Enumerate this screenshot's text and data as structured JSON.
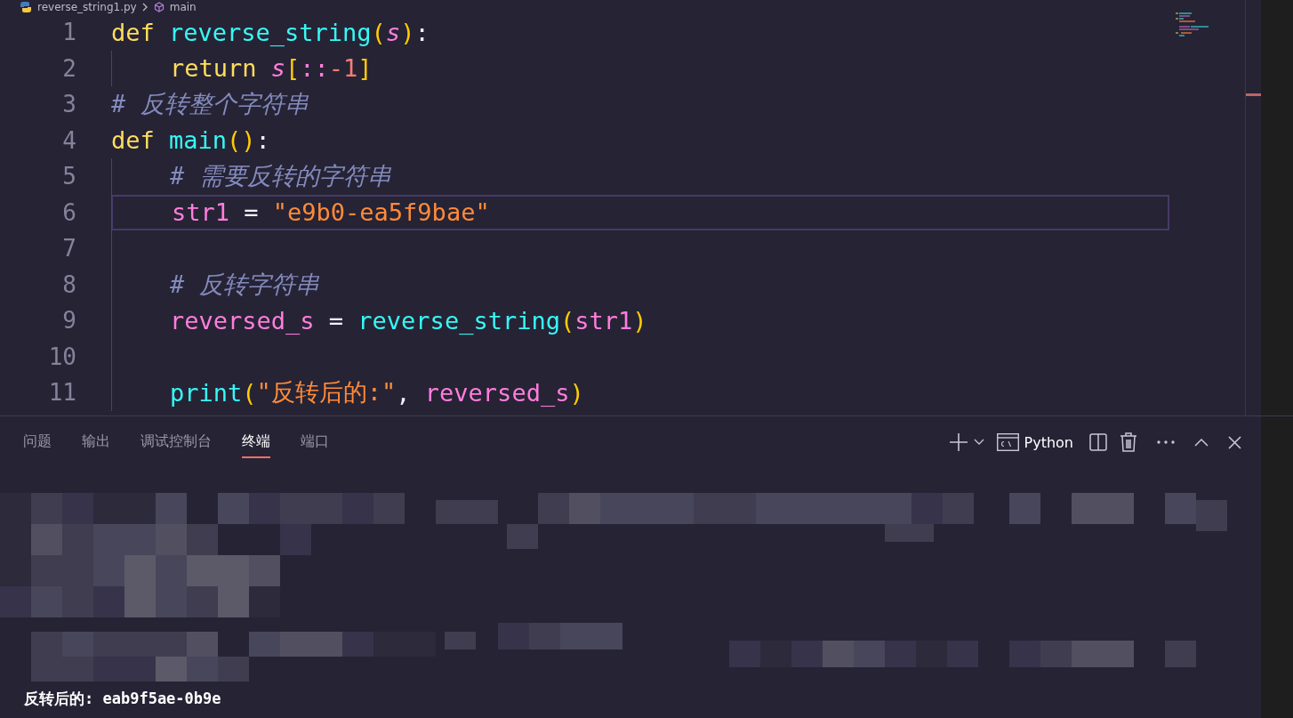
{
  "breadcrumb": [
    {
      "text": "reverse_string1.py",
      "kind": "file"
    },
    {
      "text": "main",
      "kind": "symbol"
    }
  ],
  "editor": {
    "lines": [
      {
        "number": "1",
        "current": false,
        "indented": false,
        "tokens": [
          {
            "text": "def ",
            "kind": "keyword"
          },
          {
            "text": "reverse_string",
            "kind": "function"
          },
          {
            "text": "(",
            "kind": "paren"
          },
          {
            "text": "s",
            "kind": "param"
          },
          {
            "text": ")",
            "kind": "paren"
          },
          {
            "text": ":",
            "kind": "punct"
          }
        ]
      },
      {
        "number": "2",
        "current": false,
        "indented": true,
        "tokens": [
          {
            "text": "return ",
            "kind": "keyword"
          },
          {
            "text": "s",
            "kind": "param"
          },
          {
            "text": "[",
            "kind": "paren"
          },
          {
            "text": "::",
            "kind": "variable"
          },
          {
            "text": "-1",
            "kind": "number"
          },
          {
            "text": "]",
            "kind": "paren"
          }
        ]
      },
      {
        "number": "3",
        "current": false,
        "indented": false,
        "tokens": [
          {
            "text": "# 反转整个字符串",
            "kind": "comment"
          }
        ]
      },
      {
        "number": "4",
        "current": false,
        "indented": false,
        "tokens": [
          {
            "text": "def ",
            "kind": "keyword"
          },
          {
            "text": "main",
            "kind": "function"
          },
          {
            "text": "()",
            "kind": "paren"
          },
          {
            "text": ":",
            "kind": "punct"
          }
        ]
      },
      {
        "number": "5",
        "current": false,
        "indented": true,
        "tokens": [
          {
            "text": "# 需要反转的字符串",
            "kind": "comment"
          }
        ]
      },
      {
        "number": "6",
        "current": true,
        "indented": true,
        "tokens": [
          {
            "text": "str1",
            "kind": "variable"
          },
          {
            "text": " = ",
            "kind": "punct"
          },
          {
            "text": "\"e9b0-ea5f9bae\"",
            "kind": "string"
          }
        ]
      },
      {
        "number": "7",
        "current": false,
        "indented": true
      },
      {
        "number": "8",
        "current": false,
        "indented": true,
        "tokens": [
          {
            "text": "# 反转字符串",
            "kind": "comment"
          }
        ]
      },
      {
        "number": "9",
        "current": false,
        "indented": true,
        "tokens": [
          {
            "text": "reversed_s",
            "kind": "variable"
          },
          {
            "text": " = ",
            "kind": "punct"
          },
          {
            "text": "reverse_string",
            "kind": "function"
          },
          {
            "text": "(",
            "kind": "paren"
          },
          {
            "text": "str1",
            "kind": "variable"
          },
          {
            "text": ")",
            "kind": "paren"
          }
        ]
      },
      {
        "number": "10",
        "current": false,
        "indented": true
      },
      {
        "number": "11",
        "current": false,
        "indented": true,
        "tokens": [
          {
            "text": "print",
            "kind": "function"
          },
          {
            "text": "(",
            "kind": "paren"
          },
          {
            "text": "\"反转后的:\"",
            "kind": "string"
          },
          {
            "text": ", ",
            "kind": "punct"
          },
          {
            "text": "reversed_s",
            "kind": "variable"
          },
          {
            "text": ")",
            "kind": "paren"
          }
        ]
      }
    ]
  },
  "panel": {
    "tabs": [
      {
        "label": "问题",
        "selected": false
      },
      {
        "label": "输出",
        "selected": false
      },
      {
        "label": "调试控制台",
        "selected": false
      },
      {
        "label": "终端",
        "selected": true
      },
      {
        "label": "端口",
        "selected": false
      }
    ],
    "shell": "Python",
    "terminal_output": "反转后的: eab9f5ae-0b9e"
  }
}
